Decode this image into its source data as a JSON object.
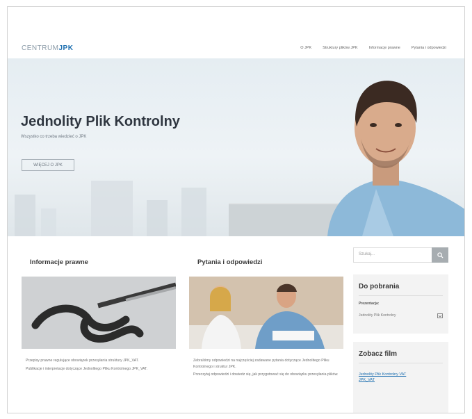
{
  "nav": {
    "logo_prefix": "CENTRUM",
    "logo_brand": "JPK",
    "items": [
      "O JPK",
      "Struktury plików JPK",
      "Informacje prawne",
      "Pytania i odpowiedzi"
    ]
  },
  "hero": {
    "title": "Jednolity Plik Kontrolny",
    "subtitle": "Wszystko co trzeba wiedzieć o JPK",
    "button_label": "WIĘCEJ O JPK"
  },
  "columns": [
    {
      "heading": "Informacje prawne",
      "text": [
        "Przepisy prawne regulujące obowiązek przesyłania struktury JPK_VAT.",
        "Publikacje i interpretacje dotyczące Jednolitego Pliku Kontrolnego JPK_VAT."
      ]
    },
    {
      "heading": "Pytania i odpowiedzi",
      "text": [
        "Zebraliśmy odpowiedzi na najczęściej zadawane pytania dotyczące Jednolitego Pliku Kontrolnego i struktur JPK.",
        "Przeczytaj odpowiedzi i dowiedz się, jak przygotować się do obowiązku przesyłania plików."
      ]
    }
  ],
  "sidebar": {
    "search_placeholder": "Szukaj...",
    "download_title": "Do pobrania",
    "download_label": "Prezentacja:",
    "download_select": "Jednolity Plik Kontrolny",
    "film_title": "Zobacz film",
    "film_link": "Jednolity Plik Kontrolny VAT JPK_VAT"
  }
}
